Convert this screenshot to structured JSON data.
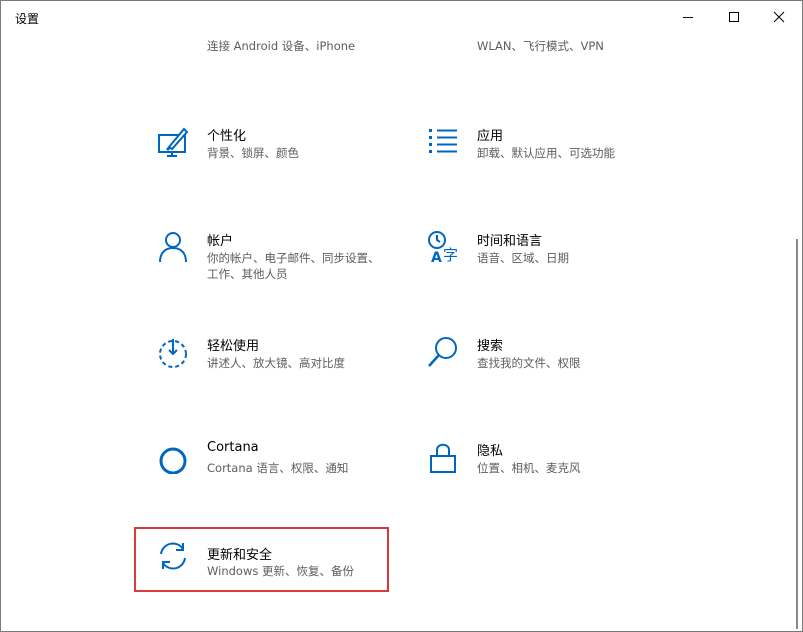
{
  "window": {
    "title": "设置"
  },
  "tiles": [
    {
      "name": "",
      "desc": "连接 Android 设备、iPhone",
      "icon": "phone-icon"
    },
    {
      "name": "",
      "desc": "WLAN、飞行模式、VPN",
      "icon": "globe-icon"
    },
    {
      "name": "个性化",
      "desc": "背景、锁屏、颜色",
      "icon": "personalization-icon"
    },
    {
      "name": "应用",
      "desc": "卸载、默认应用、可选功能",
      "icon": "apps-list-icon"
    },
    {
      "name": "帐户",
      "desc": "你的帐户、电子邮件、同步设置、工作、其他人员",
      "icon": "person-icon"
    },
    {
      "name": "时间和语言",
      "desc": "语音、区域、日期",
      "icon": "time-language-icon"
    },
    {
      "name": "轻松使用",
      "desc": "讲述人、放大镜、高对比度",
      "icon": "ease-of-access-icon"
    },
    {
      "name": "搜索",
      "desc": "查找我的文件、权限",
      "icon": "search-icon"
    },
    {
      "name": "Cortana",
      "desc": "Cortana 语言、权限、通知",
      "icon": "cortana-icon"
    },
    {
      "name": "隐私",
      "desc": "位置、相机、麦克风",
      "icon": "lock-icon"
    },
    {
      "name": "更新和安全",
      "desc": "Windows 更新、恢复、备份",
      "icon": "update-sync-icon"
    }
  ],
  "colors": {
    "accent": "#0067c0",
    "highlight": "#d93a3a"
  }
}
